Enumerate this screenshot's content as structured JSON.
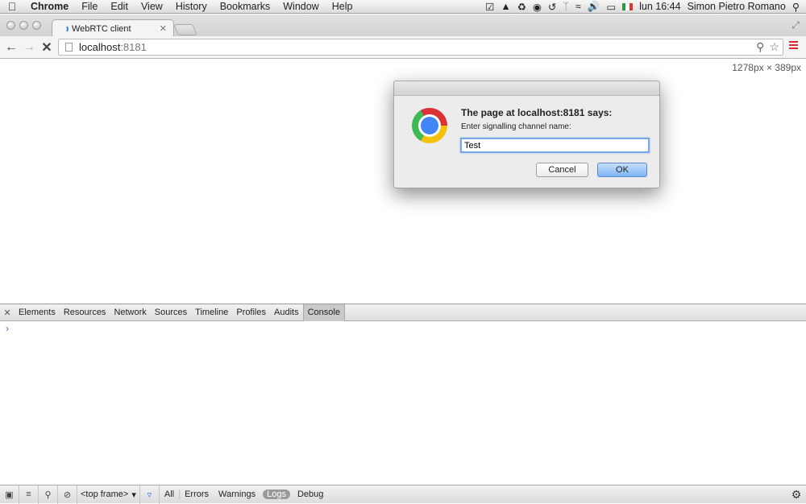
{
  "menubar": {
    "app": "Chrome",
    "menus": [
      "File",
      "Edit",
      "View",
      "History",
      "Bookmarks",
      "Window",
      "Help"
    ],
    "clock": "lun 16:44",
    "user": "Simon Pietro Romano"
  },
  "tab": {
    "title": "WebRTC client"
  },
  "address": {
    "host": "localhost",
    "port": ":8181"
  },
  "viewport": {
    "dimensions": "1278px  ×  389px"
  },
  "dialog": {
    "title": "The page at localhost:8181 says:",
    "message": "Enter signalling channel name:",
    "input_value": "Test",
    "cancel_label": "Cancel",
    "ok_label": "OK"
  },
  "devtools": {
    "tabs": [
      "Elements",
      "Resources",
      "Network",
      "Sources",
      "Timeline",
      "Profiles",
      "Audits",
      "Console"
    ],
    "prompt": "›",
    "frame": "<top frame>",
    "filters": [
      "All",
      "Errors",
      "Warnings",
      "Logs",
      "Debug"
    ]
  }
}
